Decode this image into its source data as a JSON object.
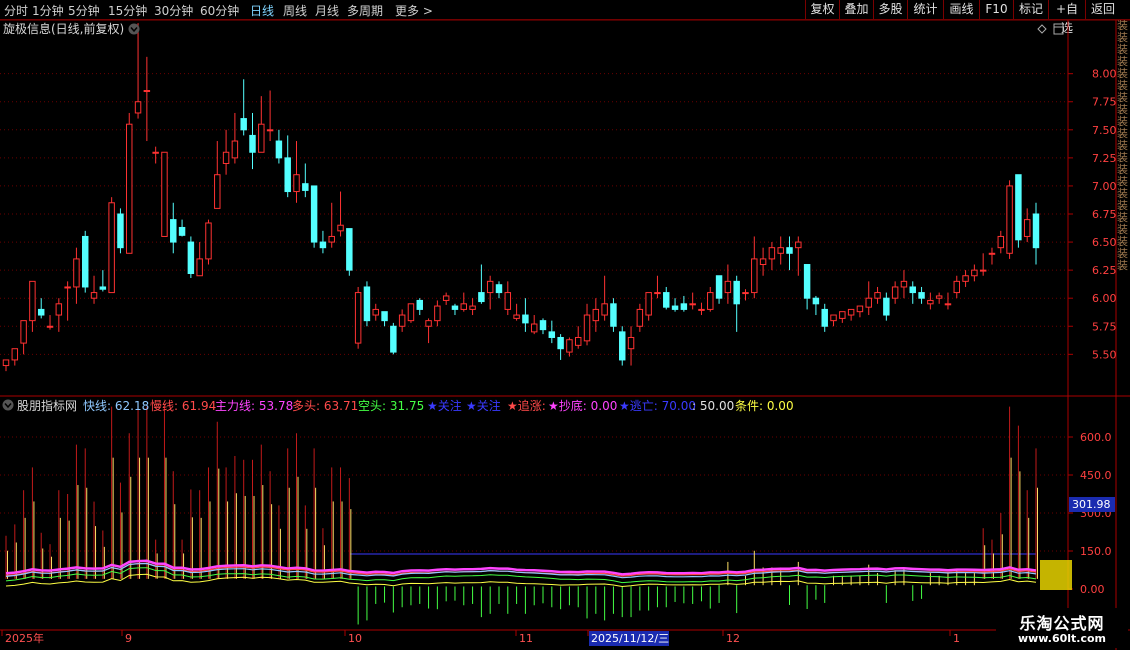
{
  "toolbar": {
    "periods": [
      "分时",
      "1分钟",
      "5分钟",
      "15分钟",
      "30分钟",
      "60分钟",
      "日线",
      "周线",
      "月线",
      "多周期",
      "更多 >"
    ],
    "active": "日线",
    "buttons": [
      "复权",
      "叠加",
      "多股",
      "统计",
      "画线",
      "F10",
      "标记",
      "+自选",
      "返回"
    ]
  },
  "main_panel": {
    "title": "旋极信息(日线,前复权)",
    "price_ticks": [
      "8.00",
      "7.75",
      "7.50",
      "7.25",
      "7.00",
      "6.75",
      "6.50",
      "6.25",
      "6.00",
      "5.75",
      "5.50"
    ]
  },
  "indicator_panel": {
    "name": "股朋指标网",
    "items": [
      {
        "label": "快线:",
        "value": "62.18",
        "color": "#8fc8ff"
      },
      {
        "label": "慢线:",
        "value": "61.94",
        "color": "#ff4a4a"
      },
      {
        "label": "主力线:",
        "value": "53.78",
        "color": "#ff44ff"
      },
      {
        "label": "多头:",
        "value": "63.71",
        "color": "#ff4a4a"
      },
      {
        "label": "空头:",
        "value": "31.75",
        "color": "#44ff44"
      },
      {
        "label": "★关注",
        "value": "",
        "color": "#3a3aff"
      },
      {
        "label": "★关注",
        "value": "",
        "color": "#3a3aff"
      },
      {
        "label": "★追涨:",
        "value": "",
        "color": "#ff4a4a"
      },
      {
        "label": "★抄底:",
        "value": "0.00",
        "color": "#ff44ff"
      },
      {
        "label": "★逃亡:",
        "value": "70.00",
        "color": "#3a3aff"
      },
      {
        "label": ":",
        "value": "50.00",
        "color": "#e0e0e0"
      },
      {
        "label": "条件:",
        "value": "0.00",
        "color": "#ffff44"
      }
    ],
    "axis_ticks": [
      "600.0",
      "450.0",
      "300.0",
      "150.0",
      "0.00"
    ],
    "current_value": "301.98"
  },
  "date_axis": {
    "labels": [
      "2025年",
      "9",
      "10",
      "11",
      "2025/11/12/三",
      "12",
      "1"
    ]
  },
  "right_strip_text": "装装装装装装装装装装装装装装装装装装装装装",
  "watermark": {
    "title": "乐淘公式网",
    "url": "www.60lt.com"
  },
  "colors": {
    "up": "#ff3232",
    "down": "#54ffff",
    "grid": "#6a0000",
    "axis": "#aa0000",
    "bg": "#000000"
  },
  "chart_data": {
    "type": "candlestick",
    "title": "旋极信息(日线,前复权)",
    "ylim": [
      5.2,
      8.3
    ],
    "candles": [
      [
        5.4,
        5.45,
        5.35,
        5.45
      ],
      [
        5.45,
        5.55,
        5.4,
        5.55
      ],
      [
        5.6,
        5.8,
        5.5,
        5.8
      ],
      [
        5.8,
        6.15,
        5.7,
        6.1
      ],
      [
        5.9,
        5.85,
        5.82,
        6.0
      ],
      [
        5.75,
        5.75,
        5.72,
        5.85
      ],
      [
        5.85,
        5.95,
        5.7,
        6.0
      ],
      [
        6.1,
        6.1,
        5.8,
        6.15
      ],
      [
        6.1,
        6.35,
        5.95,
        6.45
      ],
      [
        6.55,
        6.1,
        6.05,
        6.6
      ],
      [
        6.0,
        6.05,
        5.95,
        6.2
      ],
      [
        6.1,
        6.08,
        6.06,
        6.25
      ],
      [
        6.05,
        6.85,
        6.05,
        6.9
      ],
      [
        6.75,
        6.45,
        6.4,
        6.8
      ],
      [
        6.4,
        7.55,
        7.1,
        7.65
      ],
      [
        7.65,
        7.75,
        7.6,
        8.45
      ],
      [
        7.85,
        7.85,
        7.4,
        8.15
      ],
      [
        7.3,
        7.3,
        7.2,
        7.35
      ],
      [
        6.55,
        7.3,
        6.6,
        7.3
      ],
      [
        6.7,
        6.5,
        6.4,
        6.85
      ],
      [
        6.63,
        6.56,
        6.55,
        6.7
      ],
      [
        6.5,
        6.22,
        6.18,
        6.55
      ],
      [
        6.2,
        6.35,
        6.2,
        6.5
      ],
      [
        6.35,
        6.67,
        6.3,
        6.7
      ],
      [
        6.8,
        7.1,
        6.8,
        7.4
      ],
      [
        7.2,
        7.3,
        7.1,
        7.5
      ],
      [
        7.25,
        7.4,
        7.2,
        7.65
      ],
      [
        7.6,
        7.5,
        7.45,
        7.95
      ],
      [
        7.45,
        7.3,
        7.15,
        7.65
      ],
      [
        7.3,
        7.55,
        7.3,
        7.8
      ],
      [
        7.5,
        7.5,
        7.4,
        7.85
      ],
      [
        7.4,
        7.25,
        7.2,
        7.5
      ],
      [
        7.25,
        6.95,
        6.9,
        7.45
      ],
      [
        6.95,
        7.1,
        6.85,
        7.4
      ],
      [
        7.02,
        6.96,
        6.9,
        7.2
      ],
      [
        7.0,
        6.5,
        6.45,
        7.0
      ],
      [
        6.5,
        6.45,
        6.4,
        6.6
      ],
      [
        6.5,
        6.55,
        6.45,
        6.85
      ],
      [
        6.6,
        6.65,
        6.55,
        6.95
      ],
      [
        6.62,
        6.25,
        6.2,
        6.62
      ],
      [
        5.6,
        6.05,
        5.55,
        6.1
      ],
      [
        6.1,
        5.8,
        5.75,
        6.15
      ],
      [
        5.85,
        5.9,
        5.8,
        5.95
      ],
      [
        5.88,
        5.8,
        5.75,
        5.88
      ],
      [
        5.75,
        5.52,
        5.5,
        5.78
      ],
      [
        5.75,
        5.85,
        5.7,
        5.9
      ],
      [
        5.8,
        5.95,
        5.78,
        5.95
      ],
      [
        5.98,
        5.9,
        5.85,
        6.0
      ],
      [
        5.75,
        5.8,
        5.6,
        5.82
      ],
      [
        5.8,
        5.93,
        5.75,
        5.98
      ],
      [
        5.98,
        6.02,
        5.94,
        6.05
      ],
      [
        5.93,
        5.9,
        5.85,
        5.95
      ],
      [
        5.9,
        5.95,
        5.88,
        6.05
      ],
      [
        5.9,
        5.93,
        5.85,
        6.0
      ],
      [
        6.05,
        5.97,
        5.95,
        6.3
      ],
      [
        6.05,
        6.15,
        5.9,
        6.2
      ],
      [
        6.12,
        6.05,
        6.0,
        6.15
      ],
      [
        5.9,
        6.05,
        5.85,
        6.15
      ],
      [
        5.82,
        5.85,
        5.8,
        5.95
      ],
      [
        5.85,
        5.78,
        5.7,
        6.0
      ],
      [
        5.7,
        5.77,
        5.68,
        5.85
      ],
      [
        5.8,
        5.72,
        5.68,
        5.82
      ],
      [
        5.7,
        5.65,
        5.6,
        5.8
      ],
      [
        5.65,
        5.55,
        5.45,
        5.68
      ],
      [
        5.52,
        5.63,
        5.48,
        5.65
      ],
      [
        5.58,
        5.65,
        5.55,
        5.75
      ],
      [
        5.62,
        5.85,
        5.58,
        5.95
      ],
      [
        5.8,
        5.9,
        5.7,
        6.0
      ],
      [
        5.85,
        5.95,
        5.8,
        6.2
      ],
      [
        5.95,
        5.75,
        5.7,
        6.0
      ],
      [
        5.7,
        5.45,
        5.4,
        5.75
      ],
      [
        5.55,
        5.65,
        5.4,
        5.75
      ],
      [
        5.75,
        5.9,
        5.7,
        5.95
      ],
      [
        5.85,
        6.05,
        5.8,
        6.05
      ],
      [
        6.05,
        6.05,
        6.0,
        6.2
      ],
      [
        6.05,
        5.92,
        5.9,
        6.1
      ],
      [
        5.93,
        5.9,
        5.88,
        6.0
      ],
      [
        5.95,
        5.9,
        5.88,
        6.02
      ],
      [
        5.95,
        5.95,
        5.9,
        6.05
      ],
      [
        5.9,
        5.9,
        5.85,
        5.96
      ],
      [
        5.9,
        6.05,
        5.88,
        6.1
      ],
      [
        6.2,
        6.0,
        5.95,
        6.2
      ],
      [
        6.05,
        6.15,
        5.95,
        6.3
      ],
      [
        6.15,
        5.95,
        5.7,
        6.2
      ],
      [
        6.05,
        6.05,
        5.98,
        6.08
      ],
      [
        6.05,
        6.35,
        6.0,
        6.55
      ],
      [
        6.3,
        6.35,
        6.2,
        6.45
      ],
      [
        6.35,
        6.45,
        6.25,
        6.5
      ],
      [
        6.4,
        6.45,
        6.3,
        6.55
      ],
      [
        6.45,
        6.4,
        6.25,
        6.55
      ],
      [
        6.45,
        6.5,
        6.2,
        6.55
      ],
      [
        6.3,
        6.0,
        5.9,
        6.3
      ],
      [
        6.0,
        5.95,
        5.85,
        6.02
      ],
      [
        5.9,
        5.75,
        5.7,
        5.95
      ],
      [
        5.8,
        5.85,
        5.75,
        5.85
      ],
      [
        5.82,
        5.88,
        5.78,
        5.88
      ],
      [
        5.85,
        5.9,
        5.8,
        5.9
      ],
      [
        5.88,
        5.93,
        5.83,
        5.93
      ],
      [
        5.92,
        6.0,
        5.85,
        6.15
      ],
      [
        6.0,
        6.05,
        5.95,
        6.1
      ],
      [
        6.0,
        5.85,
        5.8,
        6.05
      ],
      [
        6.0,
        6.1,
        5.95,
        6.15
      ],
      [
        6.1,
        6.15,
        6.0,
        6.25
      ],
      [
        6.1,
        6.05,
        5.95,
        6.15
      ],
      [
        6.05,
        6.0,
        5.95,
        6.1
      ],
      [
        5.95,
        5.98,
        5.9,
        6.05
      ],
      [
        6.0,
        6.02,
        5.95,
        6.05
      ],
      [
        5.95,
        5.95,
        5.9,
        6.05
      ],
      [
        6.05,
        6.15,
        6.0,
        6.2
      ],
      [
        6.15,
        6.2,
        6.1,
        6.25
      ],
      [
        6.2,
        6.25,
        6.15,
        6.3
      ],
      [
        6.25,
        6.25,
        6.2,
        6.4
      ],
      [
        6.4,
        6.4,
        6.3,
        6.45
      ],
      [
        6.45,
        6.55,
        6.4,
        6.6
      ],
      [
        6.4,
        7.0,
        6.35,
        7.05
      ],
      [
        7.1,
        6.52,
        6.45,
        7.1
      ],
      [
        6.55,
        6.7,
        6.5,
        6.8
      ],
      [
        6.75,
        6.45,
        6.3,
        6.85
      ]
    ]
  }
}
